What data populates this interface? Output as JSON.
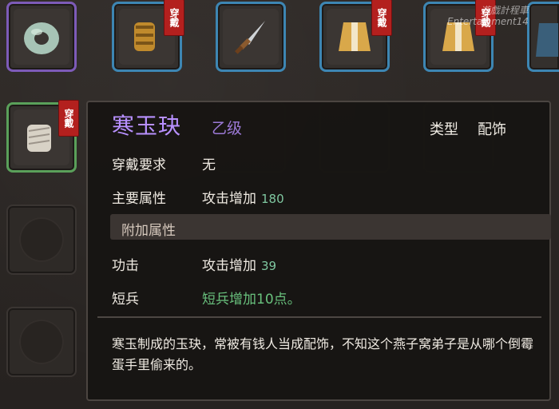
{
  "inventory": {
    "badge_label": "穿戴",
    "slots": [
      {
        "name": "jade-ring-slot",
        "rarity": "purple",
        "icon": "jade-ring-icon"
      },
      {
        "name": "gauntlet-slot",
        "rarity": "blue",
        "icon": "gauntlet-icon",
        "equipped": true
      },
      {
        "name": "dagger-slot",
        "rarity": "blue",
        "icon": "dagger-icon"
      },
      {
        "name": "robe-slot-1",
        "rarity": "blue",
        "icon": "robe-icon",
        "equipped": true
      },
      {
        "name": "robe-slot-2",
        "rarity": "blue",
        "icon": "robe-icon",
        "equipped": true
      },
      {
        "name": "partial-slot",
        "rarity": "blue",
        "icon": "robe-icon"
      },
      {
        "name": "bandage-glove-slot",
        "rarity": "green",
        "icon": "bandage-glove-icon",
        "equipped": true
      }
    ]
  },
  "tooltip": {
    "item_name": "寒玉玦",
    "grade": "乙级",
    "type_label": "类型",
    "type_value": "配饰",
    "requirement_label": "穿戴要求",
    "requirement_value": "无",
    "main_attr_label": "主要属性",
    "main_attr_text": "攻击增加",
    "main_attr_num": "180",
    "extra_section_title": "附加属性",
    "extra_1_label": "功击",
    "extra_1_text": "攻击增加",
    "extra_1_num": "39",
    "extra_2_label": "短兵",
    "extra_2_value": "短兵增加10点。",
    "description": "寒玉制成的玉玦，常被有钱人当成配饰，不知这个燕子窝弟子是从哪个倒霉蛋手里偷来的。"
  },
  "watermark": {
    "line1": "遊戲計程車",
    "line2": "Entertainment14"
  },
  "colors": {
    "rarity_purple": "#7d5bb8",
    "rarity_blue": "#3d86b3",
    "rarity_green": "#5aa05a",
    "item_name": "#b890ff",
    "bonus_green": "#69c17d",
    "badge_red": "#b3201e"
  }
}
